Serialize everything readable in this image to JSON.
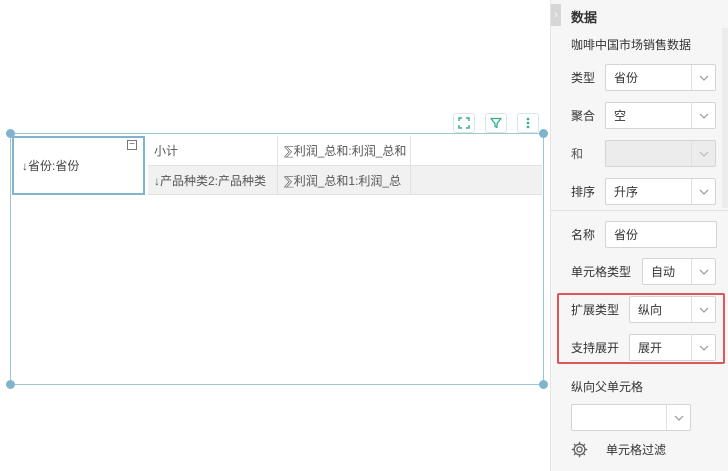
{
  "canvas": {
    "toolbar": {
      "expand_icon": "expand-icon",
      "filter_icon": "filter-icon",
      "more_icon": "more-vertical-icon"
    },
    "table": {
      "main_cell": "↓省份:省份",
      "subtotal_header": "小计",
      "sum_header": "⅀利润_总和:利润_总和",
      "product_cell": "↓产品种类2:产品种类",
      "sum_cell": "⅀利润_总和1:利润_总"
    }
  },
  "panel": {
    "title": "数据",
    "dataset": "咖啡中国市场销售数据",
    "type_label": "类型",
    "type_value": "省份",
    "agg_label": "聚合",
    "agg_value": "空",
    "sum_label": "和",
    "sum_value": "",
    "sort_label": "排序",
    "sort_value": "升序",
    "name_label": "名称",
    "name_value": "省份",
    "cell_type_label": "单元格类型",
    "cell_type_value": "自动",
    "expand_type_label": "扩展类型",
    "expand_type_value": "纵向",
    "support_expand_label": "支持展开",
    "support_expand_value": "展开",
    "parent_cell_label": "纵向父单元格",
    "parent_cell_value": "",
    "cell_filter_label": "单元格过滤"
  },
  "colors": {
    "accent": "#2fae8f",
    "selection": "#7fb4cc",
    "highlight": "#e05656"
  }
}
